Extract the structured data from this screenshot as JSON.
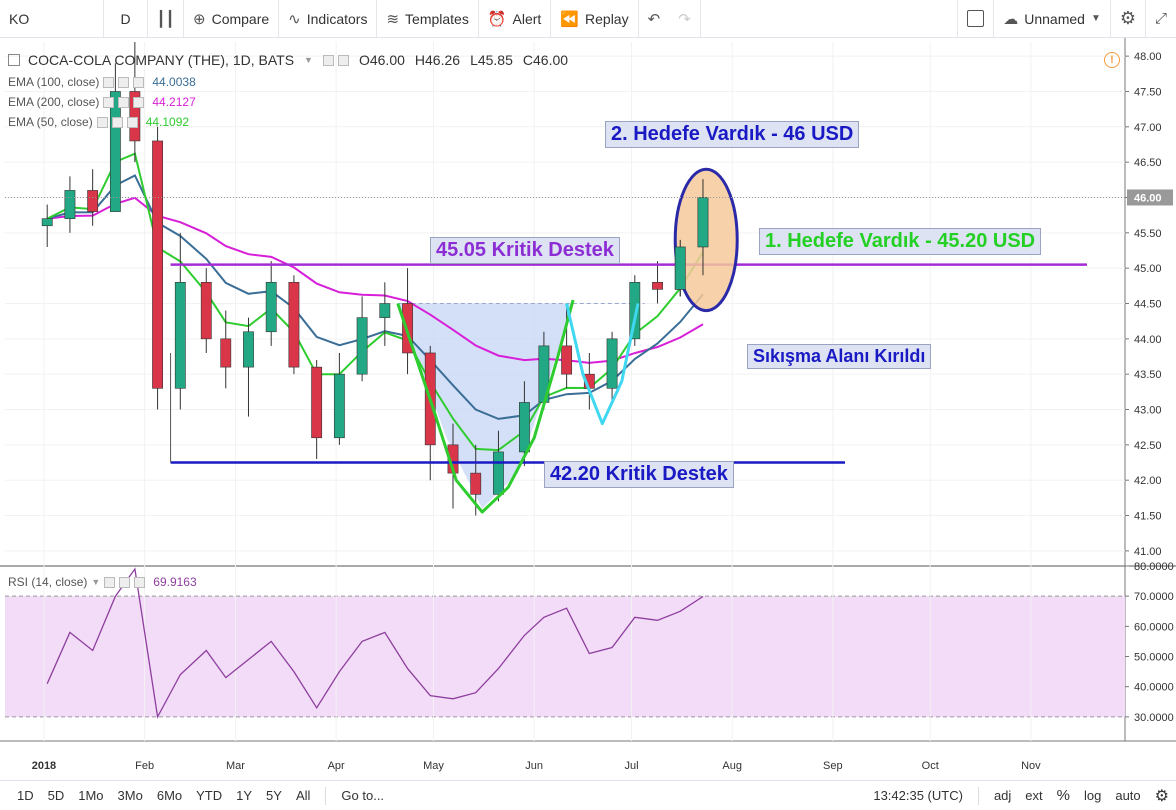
{
  "toolbar": {
    "symbol": "KO",
    "interval": "D",
    "compare": "Compare",
    "indicators": "Indicators",
    "templates": "Templates",
    "alert": "Alert",
    "replay": "Replay",
    "layout_name": "Unnamed"
  },
  "legend": {
    "symbol_title": "COCA-COLA COMPANY (THE), 1D, BATS",
    "ohlc": {
      "o": "O46.00",
      "h": "H46.26",
      "l": "L45.85",
      "c": "C46.00"
    },
    "ema100": {
      "label": "EMA (100, close)",
      "value": "44.0038",
      "color": "#3a6e96"
    },
    "ema200": {
      "label": "EMA (200, close)",
      "value": "44.2127",
      "color": "#d81fd8"
    },
    "ema50": {
      "label": "EMA (50, close)",
      "value": "44.1092",
      "color": "#2ecc2e"
    },
    "rsi": {
      "label": "RSI (14, close)",
      "value": "69.9163",
      "color": "#8e3e9e"
    }
  },
  "annotations": {
    "target2": "2. Hedefe Vardık - 46 USD",
    "target1": "1. Hedefe Vardık - 45.20 USD",
    "support1": "45.05 Kritik Destek",
    "squeeze": "Sıkışma Alanı Kırıldı",
    "support2": "42.20 Kritik Destek"
  },
  "price_axis": {
    "labels": [
      "48.00",
      "47.50",
      "47.00",
      "46.50",
      "46.00",
      "45.50",
      "45.00",
      "44.50",
      "44.00",
      "43.50",
      "43.00",
      "42.50",
      "42.00",
      "41.50",
      "41.00"
    ],
    "last_price": "46.00"
  },
  "rsi_axis": {
    "labels": [
      "80.0000",
      "70.0000",
      "60.0000",
      "50.0000",
      "40.0000",
      "30.0000"
    ]
  },
  "time_axis": {
    "labels": [
      "2018",
      "Feb",
      "Mar",
      "Apr",
      "May",
      "Jun",
      "Jul",
      "Aug",
      "Sep",
      "Oct",
      "Nov"
    ]
  },
  "bottom": {
    "ranges": [
      "1D",
      "5D",
      "1Mo",
      "3Mo",
      "6Mo",
      "YTD",
      "1Y",
      "5Y",
      "All"
    ],
    "goto": "Go to...",
    "clock": "13:42:35 (UTC)",
    "adj": "adj",
    "ext": "ext",
    "pct": "%",
    "log": "log",
    "auto": "auto"
  },
  "chart_data": {
    "type": "candlestick",
    "title": "COCA-COLA COMPANY (THE), 1D, BATS",
    "ylim": [
      40.8,
      48.2
    ],
    "rsi_ylim": [
      22,
      80
    ],
    "levels": [
      {
        "name": "45.05 Kritik Destek",
        "value": 45.05,
        "color": "#a42cd4"
      },
      {
        "name": "42.20 Kritik Destek",
        "value": 42.25,
        "color": "#1a1ac4"
      }
    ],
    "candles": [
      {
        "date": "2018-01-02",
        "o": 45.6,
        "h": 45.9,
        "l": 45.3,
        "c": 45.7
      },
      {
        "date": "2018-01-09",
        "o": 45.7,
        "h": 46.3,
        "l": 45.5,
        "c": 46.1
      },
      {
        "date": "2018-01-16",
        "o": 46.1,
        "h": 46.4,
        "l": 45.6,
        "c": 45.8
      },
      {
        "date": "2018-01-23",
        "o": 45.8,
        "h": 47.9,
        "l": 45.8,
        "c": 47.5
      },
      {
        "date": "2018-01-29",
        "o": 47.5,
        "h": 48.2,
        "l": 46.5,
        "c": 46.8
      },
      {
        "date": "2018-02-05",
        "o": 46.8,
        "h": 47.0,
        "l": 43.0,
        "c": 43.3
      },
      {
        "date": "2018-02-12",
        "o": 43.3,
        "h": 45.5,
        "l": 43.0,
        "c": 44.8
      },
      {
        "date": "2018-02-20",
        "o": 44.8,
        "h": 45.0,
        "l": 43.8,
        "c": 44.0
      },
      {
        "date": "2018-02-26",
        "o": 44.0,
        "h": 44.4,
        "l": 43.3,
        "c": 43.6
      },
      {
        "date": "2018-03-05",
        "o": 43.6,
        "h": 44.3,
        "l": 42.9,
        "c": 44.1
      },
      {
        "date": "2018-03-12",
        "o": 44.1,
        "h": 45.1,
        "l": 43.9,
        "c": 44.8
      },
      {
        "date": "2018-03-19",
        "o": 44.8,
        "h": 44.9,
        "l": 43.5,
        "c": 43.6
      },
      {
        "date": "2018-03-26",
        "o": 43.6,
        "h": 43.7,
        "l": 42.3,
        "c": 42.6
      },
      {
        "date": "2018-04-02",
        "o": 42.6,
        "h": 43.8,
        "l": 42.5,
        "c": 43.5
      },
      {
        "date": "2018-04-09",
        "o": 43.5,
        "h": 44.6,
        "l": 43.4,
        "c": 44.3
      },
      {
        "date": "2018-04-16",
        "o": 44.3,
        "h": 44.8,
        "l": 43.9,
        "c": 44.5
      },
      {
        "date": "2018-04-23",
        "o": 44.5,
        "h": 45.0,
        "l": 43.5,
        "c": 43.8
      },
      {
        "date": "2018-04-30",
        "o": 43.8,
        "h": 43.9,
        "l": 42.0,
        "c": 42.5
      },
      {
        "date": "2018-05-07",
        "o": 42.5,
        "h": 42.8,
        "l": 41.6,
        "c": 42.1
      },
      {
        "date": "2018-05-14",
        "o": 42.1,
        "h": 42.5,
        "l": 41.5,
        "c": 41.8
      },
      {
        "date": "2018-05-21",
        "o": 41.8,
        "h": 42.7,
        "l": 41.7,
        "c": 42.4
      },
      {
        "date": "2018-05-29",
        "o": 42.4,
        "h": 43.4,
        "l": 42.2,
        "c": 43.1
      },
      {
        "date": "2018-06-04",
        "o": 43.1,
        "h": 44.1,
        "l": 43.0,
        "c": 43.9
      },
      {
        "date": "2018-06-11",
        "o": 43.9,
        "h": 44.5,
        "l": 43.3,
        "c": 43.5
      },
      {
        "date": "2018-06-18",
        "o": 43.5,
        "h": 43.8,
        "l": 43.0,
        "c": 43.3
      },
      {
        "date": "2018-06-25",
        "o": 43.3,
        "h": 44.1,
        "l": 43.1,
        "c": 44.0
      },
      {
        "date": "2018-07-02",
        "o": 44.0,
        "h": 44.9,
        "l": 43.9,
        "c": 44.8
      },
      {
        "date": "2018-07-09",
        "o": 44.8,
        "h": 45.1,
        "l": 44.5,
        "c": 44.7
      },
      {
        "date": "2018-07-16",
        "o": 44.7,
        "h": 45.4,
        "l": 44.6,
        "c": 45.3
      },
      {
        "date": "2018-07-23",
        "o": 45.3,
        "h": 46.26,
        "l": 44.9,
        "c": 46.0
      }
    ],
    "rsi": [
      {
        "date": "2018-01-02",
        "v": 41
      },
      {
        "date": "2018-01-09",
        "v": 58
      },
      {
        "date": "2018-01-16",
        "v": 52
      },
      {
        "date": "2018-01-23",
        "v": 70
      },
      {
        "date": "2018-01-29",
        "v": 79
      },
      {
        "date": "2018-02-05",
        "v": 30
      },
      {
        "date": "2018-02-12",
        "v": 44
      },
      {
        "date": "2018-02-20",
        "v": 52
      },
      {
        "date": "2018-02-26",
        "v": 43
      },
      {
        "date": "2018-03-05",
        "v": 49
      },
      {
        "date": "2018-03-12",
        "v": 55
      },
      {
        "date": "2018-03-19",
        "v": 45
      },
      {
        "date": "2018-03-26",
        "v": 33
      },
      {
        "date": "2018-04-02",
        "v": 45
      },
      {
        "date": "2018-04-09",
        "v": 55
      },
      {
        "date": "2018-04-16",
        "v": 58
      },
      {
        "date": "2018-04-23",
        "v": 46
      },
      {
        "date": "2018-04-30",
        "v": 37
      },
      {
        "date": "2018-05-07",
        "v": 36
      },
      {
        "date": "2018-05-14",
        "v": 38
      },
      {
        "date": "2018-05-21",
        "v": 46
      },
      {
        "date": "2018-05-29",
        "v": 57
      },
      {
        "date": "2018-06-04",
        "v": 63
      },
      {
        "date": "2018-06-11",
        "v": 66
      },
      {
        "date": "2018-06-18",
        "v": 51
      },
      {
        "date": "2018-06-25",
        "v": 53
      },
      {
        "date": "2018-07-02",
        "v": 63
      },
      {
        "date": "2018-07-09",
        "v": 62
      },
      {
        "date": "2018-07-16",
        "v": 65
      },
      {
        "date": "2018-07-23",
        "v": 69.9
      }
    ]
  }
}
